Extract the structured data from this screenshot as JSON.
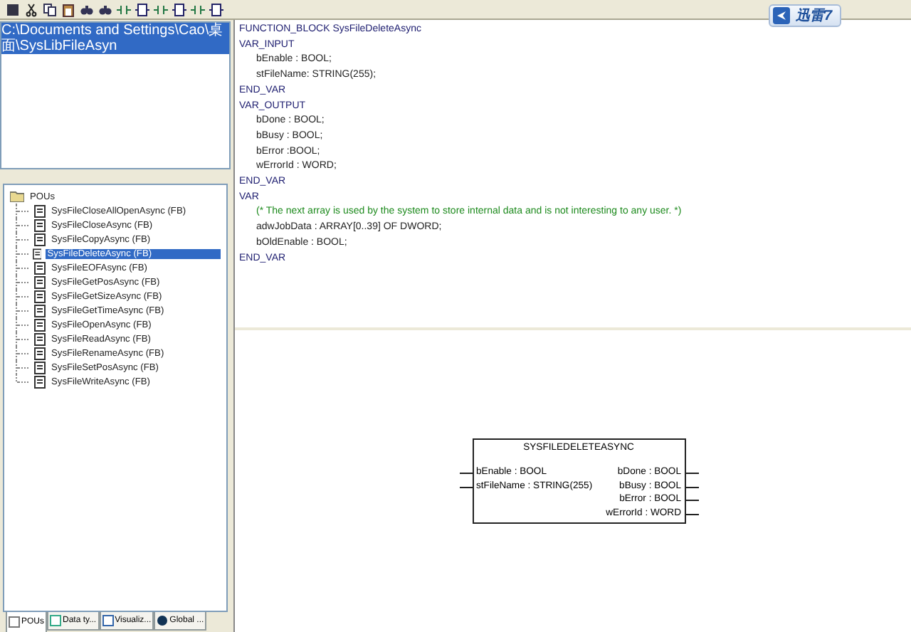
{
  "toolbar_badge": {
    "label": "迅雷7"
  },
  "path_bar": {
    "text": "C:\\Documents and Settings\\Cao\\桌面\\SysLibFileAsyn"
  },
  "tree": {
    "root": "POUs",
    "children": [
      {
        "label": "SysFileCloseAllOpenAsync (FB)",
        "selected": false
      },
      {
        "label": "SysFileCloseAsync (FB)",
        "selected": false
      },
      {
        "label": "SysFileCopyAsync (FB)",
        "selected": false
      },
      {
        "label": "SysFileDeleteAsync (FB)",
        "selected": true
      },
      {
        "label": "SysFileEOFAsync (FB)",
        "selected": false
      },
      {
        "label": "SysFileGetPosAsync (FB)",
        "selected": false
      },
      {
        "label": "SysFileGetSizeAsync (FB)",
        "selected": false
      },
      {
        "label": "SysFileGetTimeAsync (FB)",
        "selected": false
      },
      {
        "label": "SysFileOpenAsync (FB)",
        "selected": false
      },
      {
        "label": "SysFileReadAsync (FB)",
        "selected": false
      },
      {
        "label": "SysFileRenameAsync (FB)",
        "selected": false
      },
      {
        "label": "SysFileSetPosAsync (FB)",
        "selected": false
      },
      {
        "label": "SysFileWriteAsync (FB)",
        "selected": false
      }
    ]
  },
  "bottom_tabs": [
    {
      "label": "POUs",
      "kind": "pou",
      "selected": true
    },
    {
      "label": "Data ty...",
      "kind": "datatype",
      "selected": false
    },
    {
      "label": "Visualiz...",
      "kind": "visual",
      "selected": false
    },
    {
      "label": "Global ...",
      "kind": "global",
      "selected": false
    }
  ],
  "declaration": [
    {
      "text": "FUNCTION_BLOCK SysFileDeleteAsync",
      "kind": "keyword"
    },
    {
      "text": "VAR_INPUT",
      "kind": "keyword"
    },
    {
      "text": "bEnable : BOOL;",
      "kind": "code"
    },
    {
      "text": "stFileName: STRING(255);",
      "kind": "code"
    },
    {
      "text": "END_VAR",
      "kind": "keyword"
    },
    {
      "text": "VAR_OUTPUT",
      "kind": "keyword"
    },
    {
      "text": "bDone : BOOL;",
      "kind": "code"
    },
    {
      "text": "bBusy : BOOL;",
      "kind": "code"
    },
    {
      "text": "bError :BOOL;",
      "kind": "code"
    },
    {
      "text": "wErrorId : WORD;",
      "kind": "code"
    },
    {
      "text": "END_VAR",
      "kind": "keyword"
    },
    {
      "text": "VAR",
      "kind": "keyword"
    },
    {
      "text": "(* The next array is used by the system to store internal data and is not interesting to any user. *)",
      "kind": "comment"
    },
    {
      "text": "adwJobData : ARRAY[0..39] OF DWORD;",
      "kind": "code"
    },
    {
      "text": "bOldEnable : BOOL;",
      "kind": "code"
    },
    {
      "text": "END_VAR",
      "kind": "keyword"
    }
  ],
  "block": {
    "title": "SYSFILEDELETEASYNC",
    "inputs": [
      "bEnable : BOOL",
      "stFileName : STRING(255)"
    ],
    "outputs": [
      "bDone : BOOL",
      "bBusy : BOOL",
      "bError : BOOL",
      "wErrorId : WORD"
    ]
  }
}
